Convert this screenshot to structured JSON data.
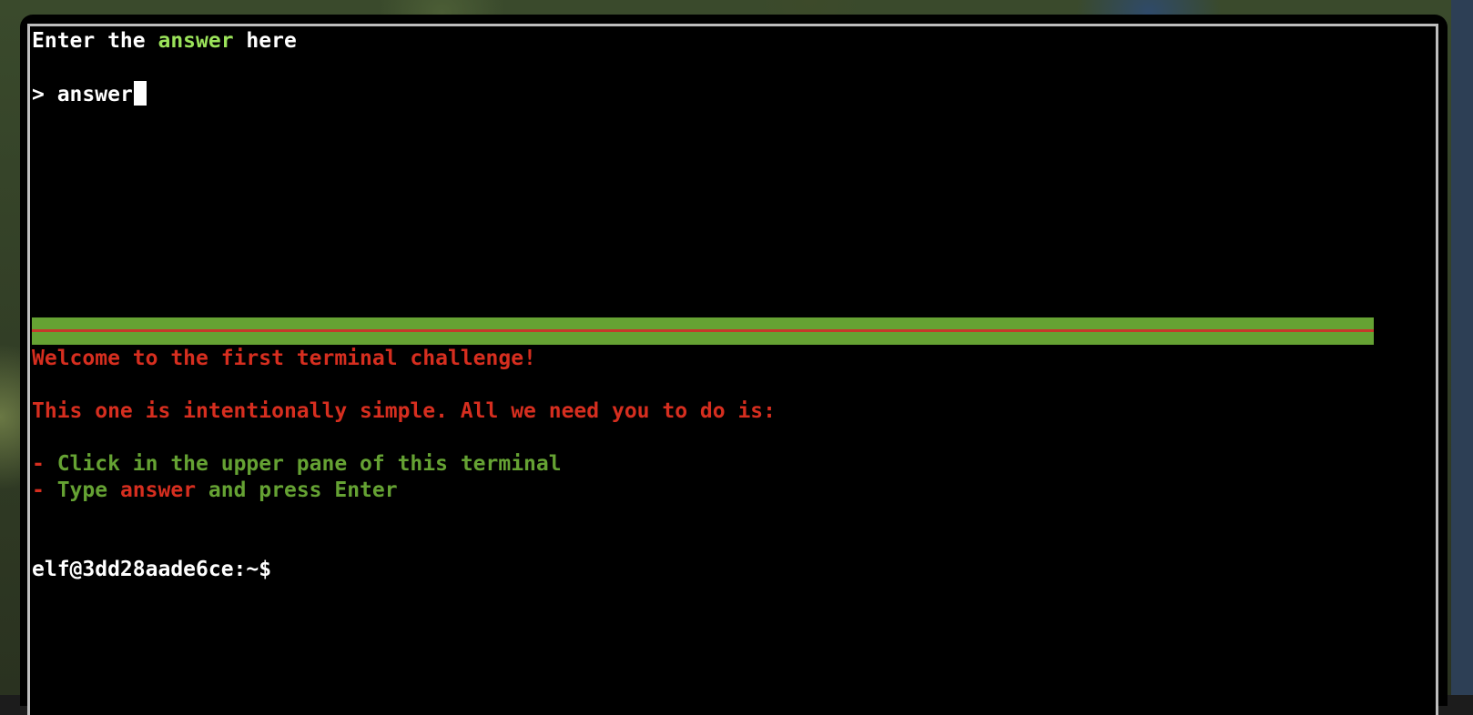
{
  "upper_pane": {
    "prompt_prefix": "Enter the ",
    "prompt_keyword": "answer",
    "prompt_suffix": " here",
    "input_marker": "> ",
    "input_value": "answer"
  },
  "lower_pane": {
    "welcome": "Welcome to the first terminal challenge!",
    "intro": "This one is intentionally simple. All we need you to do is:",
    "steps": [
      {
        "dash": "- ",
        "text": "Click in the upper pane of this terminal"
      },
      {
        "dash": "- ",
        "pre": "Type ",
        "keyword": "answer",
        "post": " and press Enter"
      }
    ],
    "shell_prompt": "elf@3dd28aade6ce:~$"
  },
  "colors": {
    "keyword_bright_green": "#9be35a",
    "instruction_red": "#d62e1f",
    "instruction_green": "#65a233",
    "divider_green": "#65a233",
    "divider_red": "#c5392a",
    "terminal_bg": "#000000",
    "frame_border": "#bdbdbd"
  }
}
